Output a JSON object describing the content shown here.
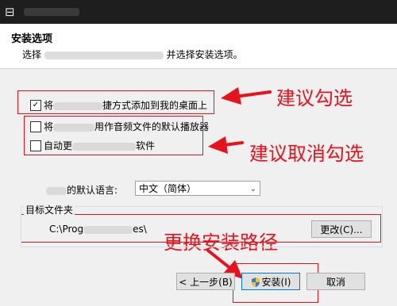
{
  "titlebar": {
    "app_icon": "installer-icon"
  },
  "header": {
    "title": "安装选项",
    "subtitle_prefix": "选择",
    "subtitle_suffix": "并选择安装选项。"
  },
  "options": [
    {
      "checked": true,
      "prefix": "将",
      "suffix": "捷方式添加到我的桌面上"
    },
    {
      "checked": false,
      "prefix": "将",
      "suffix": "用作音频文件的默认播放器"
    },
    {
      "checked": false,
      "prefix": "自动更",
      "suffix": "软件"
    }
  ],
  "language": {
    "label": "的默认语言:",
    "selected": "中文（简体）"
  },
  "target": {
    "group_label": "目标文件夹",
    "path_prefix": "C:\\Prog",
    "path_suffix": "es\\",
    "change_button": "更改(C)..."
  },
  "buttons": {
    "back": "< 上一步(B)",
    "install": "安装(I)",
    "cancel": "取消"
  },
  "annotations": {
    "recommend_check": "建议勾选",
    "recommend_uncheck": "建议取消勾选",
    "change_path": "更换安装路径"
  },
  "colors": {
    "annotation_red": "#e8121c",
    "titlebar": "#1e1e1e"
  }
}
